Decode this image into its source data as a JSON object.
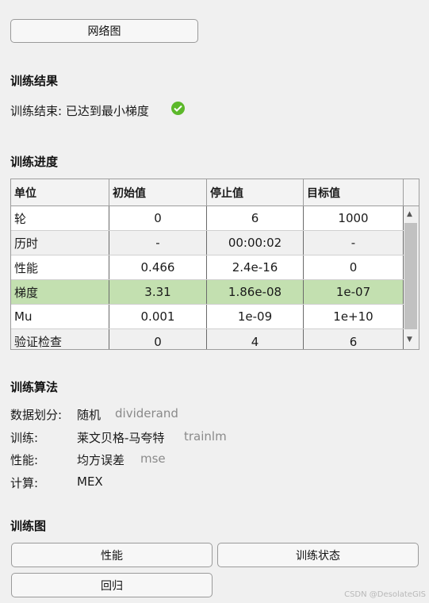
{
  "network_button": "网络图",
  "results": {
    "heading": "训练结果",
    "status_label": "训练结束: 已达到最小梯度",
    "status_icon": "check-circle-icon",
    "status_color": "#5cb82a"
  },
  "progress": {
    "heading": "训练进度",
    "columns": [
      "单位",
      "初始值",
      "停止值",
      "目标值"
    ],
    "rows": [
      [
        "轮",
        "0",
        "6",
        "1000"
      ],
      [
        "历时",
        "-",
        "00:00:02",
        "-"
      ],
      [
        "性能",
        "0.466",
        "2.4e-16",
        "0"
      ],
      [
        "梯度",
        "3.31",
        "1.86e-08",
        "1e-07"
      ],
      [
        "Mu",
        "0.001",
        "1e-09",
        "1e+10"
      ],
      [
        "验证检查",
        "0",
        "4",
        "6"
      ]
    ],
    "highlight_color": "#c3e0b0"
  },
  "algorithms": {
    "heading": "训练算法",
    "items": [
      {
        "label": "数据划分:",
        "value": "随机",
        "code": "dividerand"
      },
      {
        "label": "训练:",
        "value": "莱文贝格-马夸特",
        "code": "trainlm"
      },
      {
        "label": "性能:",
        "value": "均方误差",
        "code": "mse"
      },
      {
        "label": "计算:",
        "value": "MEX",
        "code": ""
      }
    ]
  },
  "plots": {
    "heading": "训练图",
    "performance_button": "性能",
    "state_button": "训练状态",
    "regression_button": "回归"
  },
  "watermark": "CSDN @DesolateGIS"
}
